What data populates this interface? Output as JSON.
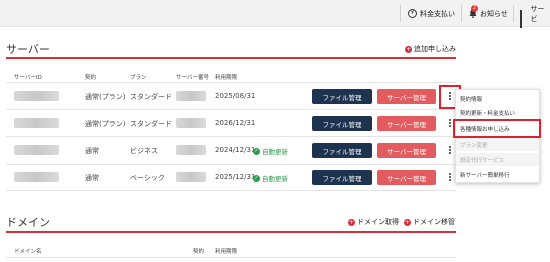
{
  "topbar": {
    "payment_label": "料金支払い",
    "notice_label": "お知らせ",
    "notice_count": "2",
    "services_label": "サービ"
  },
  "servers": {
    "title": "サーバー",
    "add_label": "追加申し込み",
    "headers": [
      "サーバーID",
      "契約",
      "プラン",
      "サーバー番号",
      "利用期限"
    ],
    "rows": [
      {
        "contract": "通常(プラン)",
        "plan": "スタンダード",
        "expiry": "2025/08/31",
        "status": ""
      },
      {
        "contract": "通常(プラン)",
        "plan": "スタンダード",
        "expiry": "2026/12/31",
        "status": ""
      },
      {
        "contract": "通常",
        "plan": "ビジネス",
        "expiry": "2024/12/31",
        "status": "自動更新"
      },
      {
        "contract": "通常",
        "plan": "ベーシック",
        "expiry": "2025/12/31",
        "status": "自動更新"
      }
    ],
    "file_btn": "ファイル管理",
    "server_btn": "サーバー管理"
  },
  "menu": {
    "items": [
      {
        "label": "契約情報",
        "disabled": false
      },
      {
        "label": "契約更新・料金支払い",
        "disabled": false
      },
      {
        "label": "各種情報お申し込み",
        "disabled": false
      },
      {
        "label": "プラン変更",
        "disabled": true
      },
      {
        "label": "設定代行サービス",
        "disabled": true
      },
      {
        "label": "新サーバー簡単移行",
        "disabled": false
      }
    ]
  },
  "domains": {
    "title": "ドメイン",
    "acquire_label": "ドメイン取得",
    "transfer_label": "ドメイン移管",
    "headers": [
      "ドメイン名",
      "契約",
      "利用期限"
    ]
  },
  "colors": {
    "accent_red": "#d92f3a",
    "navy": "#1e3350",
    "coral": "#e25b5f",
    "green": "#2e9b4e"
  }
}
